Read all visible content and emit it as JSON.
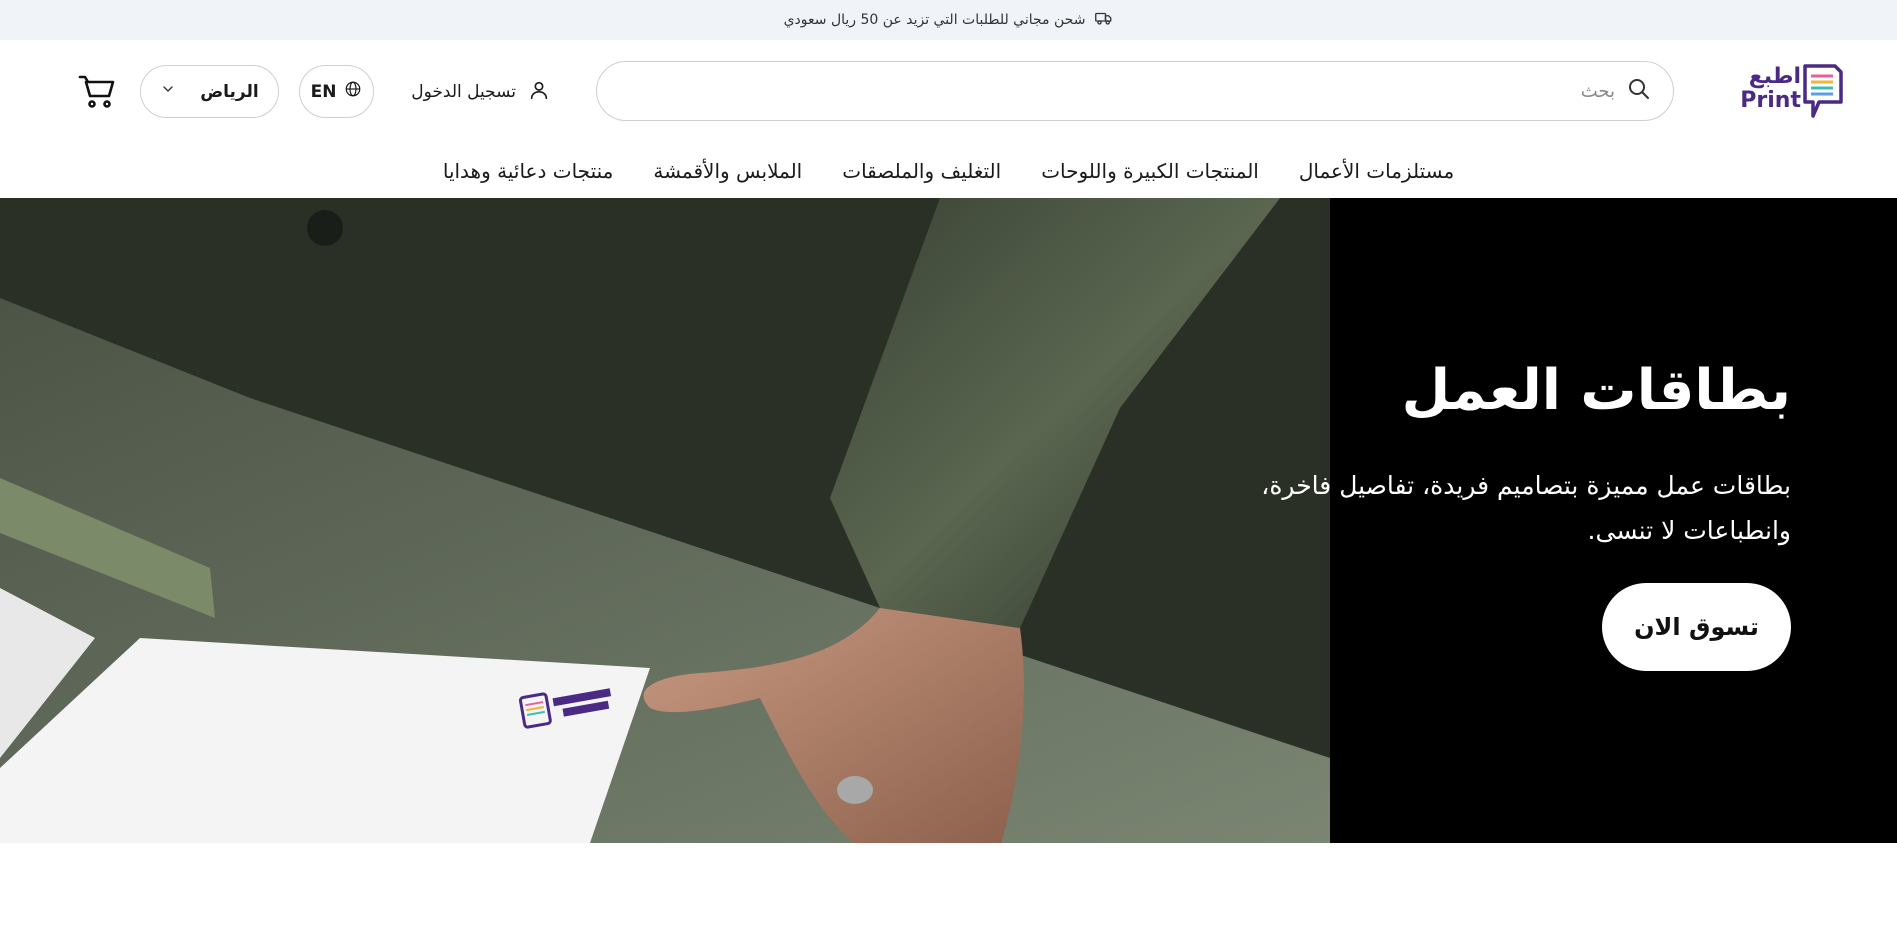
{
  "promo": {
    "text": "شحن مجاني للطلبات التي تزيد عن 50 ريال سعودي",
    "icon": "truck-icon"
  },
  "header": {
    "logo": {
      "text_ar": "اطبع",
      "text_en": "Print"
    },
    "search": {
      "placeholder": "بحث",
      "value": "",
      "icon": "search-icon"
    },
    "login": {
      "label": "تسجيل الدخول",
      "icon": "user-icon"
    },
    "language": {
      "label": "EN",
      "icon": "globe-icon"
    },
    "city": {
      "selected": "الرياض",
      "icon": "chevron-down-icon"
    },
    "cart": {
      "icon": "cart-icon"
    }
  },
  "nav": {
    "items": [
      {
        "label": "مستلزمات الأعمال"
      },
      {
        "label": "المنتجات الكبيرة واللوحات"
      },
      {
        "label": "التغليف والملصقات"
      },
      {
        "label": "الملابس والأقمشة"
      },
      {
        "label": "منتجات دعائية وهدايا"
      }
    ]
  },
  "hero": {
    "title": "بطاقات العمل",
    "subtitle": "بطاقات عمل مميزة بتصاميم فريدة، تفاصيل فاخرة، وانطباعات لا تنسى.",
    "cta_label": "تسوق الان",
    "colors": {
      "background": "#000000",
      "sleeve": "#4f5a47",
      "table": "#6f7a68",
      "card": "#f4f4f4",
      "brand": "#4b2a86"
    }
  }
}
